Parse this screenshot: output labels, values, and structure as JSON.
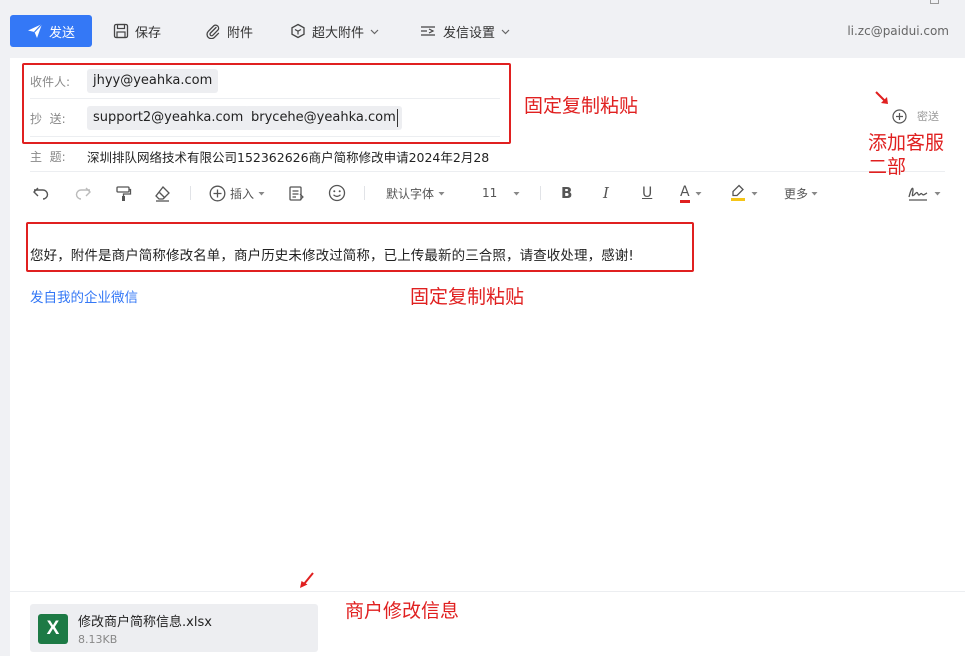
{
  "toolbar": {
    "send": "发送",
    "save": "保存",
    "attach": "附件",
    "big_attach": "超大附件",
    "send_settings": "发信设置",
    "account": "li.zc@paidui.com"
  },
  "compose": {
    "to_label": "收件人:",
    "to": [
      "jhyy@yeahka.com"
    ],
    "cc_label": "抄  送:",
    "cc": [
      "support2@yeahka.com",
      "brycehe@yeahka.com"
    ],
    "bcc_label": "密送",
    "subject_label": "主  题:",
    "subject": "深圳排队网络技术有限公司152362626商户简称修改申请2024年2月28"
  },
  "editor_toolbar": {
    "insert": "插入",
    "font": "默认字体",
    "size": "11",
    "bold": "B",
    "italic": "I",
    "underline": "U",
    "font_color": "A",
    "more": "更多"
  },
  "body": {
    "text": "您好，附件是商户简称修改名单，商户历史未修改过简称，已上传最新的三合照，请查收处理，感谢!",
    "signature": "发自我的企业微信"
  },
  "attachment": {
    "icon_letter": "X",
    "name": "修改商户简称信息.xlsx",
    "size": "8.13KB"
  },
  "annotations": {
    "header_note": "固定复制粘贴",
    "bcc_note": "添加客服\n二部",
    "body_note": "固定复制粘贴",
    "attachment_note": "商户修改信息"
  },
  "colors": {
    "accent": "#3478f6",
    "annotation": "#e02020",
    "excel": "#1d7a45"
  }
}
